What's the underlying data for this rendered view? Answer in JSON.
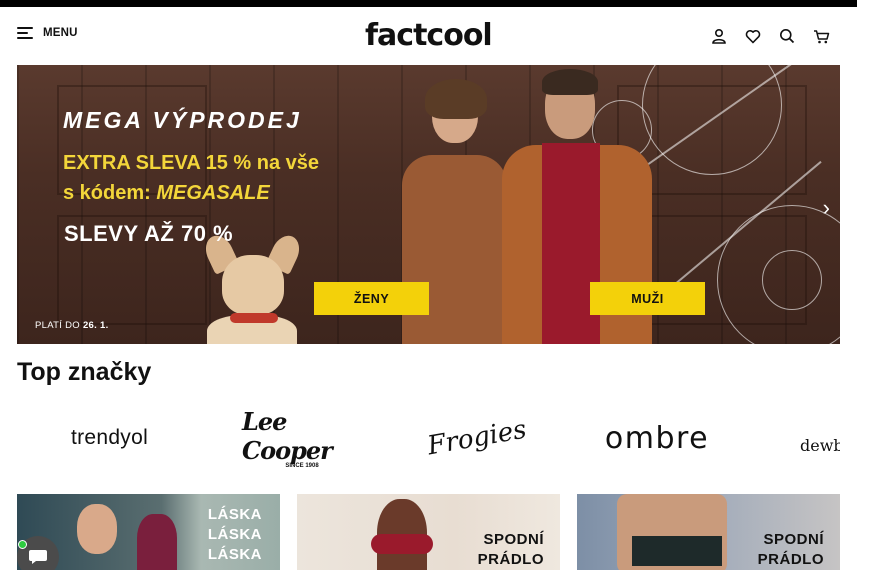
{
  "header": {
    "menu_label": "MENU",
    "logo_text": "factcool",
    "icons": [
      "user-icon",
      "heart-icon",
      "search-icon",
      "cart-icon"
    ]
  },
  "hero": {
    "title": "MEGA VÝPRODEJ",
    "extra_line1": "EXTRA SLEVA 15 % na vše",
    "extra_line2_prefix": "s kódem: ",
    "extra_code": "MEGASALE",
    "discount_text": "SLEVY AŽ 70 %",
    "valid_prefix": "PLATÍ DO",
    "valid_date": "26. 1.",
    "cta_women": "ŽENY",
    "cta_men": "MUŽI",
    "accent_color": "#f3d10a"
  },
  "brands_section": {
    "title": "Top značky",
    "brands": [
      {
        "name": "trendyol"
      },
      {
        "name": "Lee Cooper",
        "tagline": "SINCE 1908"
      },
      {
        "name": "Frogies"
      },
      {
        "name": "ombre"
      },
      {
        "name": "dewb"
      }
    ]
  },
  "promo_cards": [
    {
      "line1": "LÁSKA",
      "line2": "LÁSKA",
      "line3": "LÁSKA"
    },
    {
      "line1": "SPODNÍ",
      "line2": "PRÁDLO"
    },
    {
      "line1": "SPODNÍ",
      "line2": "PRÁDLO"
    }
  ]
}
